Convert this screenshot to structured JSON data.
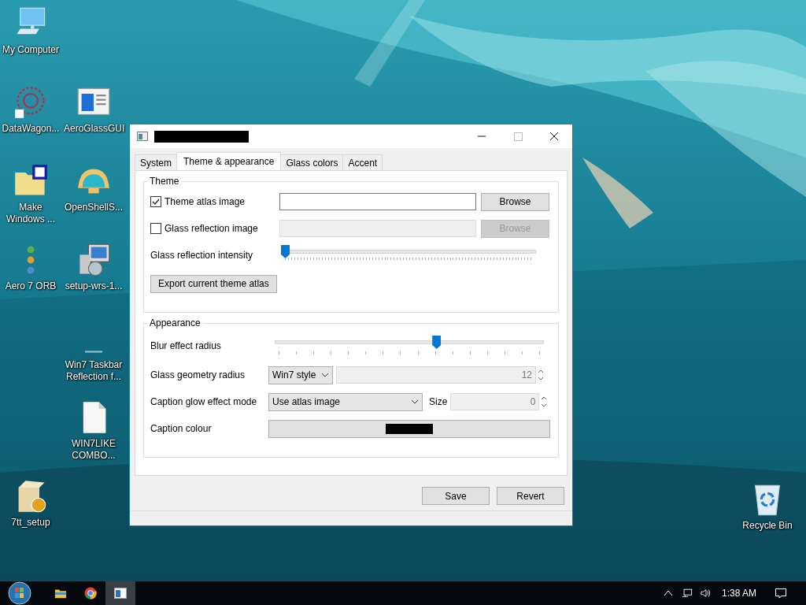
{
  "desktop_icons": [
    {
      "label": "My Computer",
      "kind": "computer"
    },
    {
      "label": "DataWagon...",
      "kind": "web"
    },
    {
      "label": "AeroGlassGUI",
      "kind": "window"
    },
    {
      "label": "Make Windows ...",
      "kind": "folder"
    },
    {
      "label": "OpenShellS...",
      "kind": "shell"
    },
    {
      "label": "Aero 7 ORB",
      "kind": "orbs"
    },
    {
      "label": "setup-wrs-1...",
      "kind": "installer"
    },
    {
      "label": "Win7 Taskbar Reflection f...",
      "kind": "blank"
    },
    {
      "label": "WIN7LIKE COMBO...",
      "kind": "file"
    },
    {
      "label": "7tt_setup",
      "kind": "box"
    }
  ],
  "recycle_bin": {
    "label": "Recycle Bin"
  },
  "tabs": [
    {
      "label": "System",
      "selected": false
    },
    {
      "label": "Theme & appearance",
      "selected": true
    },
    {
      "label": "Glass colors",
      "selected": false
    },
    {
      "label": "Accent",
      "selected": false
    }
  ],
  "theme_group": {
    "title": "Theme",
    "atlas_image": {
      "label": "Theme atlas image",
      "checked": true,
      "disabled": false,
      "button": "Browse"
    },
    "reflection_image": {
      "label": "Glass reflection image",
      "checked": false,
      "disabled": true,
      "button": "Browse"
    },
    "reflection_intensity": {
      "label": "Glass reflection intensity",
      "level": 0
    },
    "export_button": "Export current theme atlas"
  },
  "appearance_group": {
    "title": "Appearance",
    "blur_radius": {
      "label": "Blur effect radius",
      "level": 0.6
    },
    "geometry_radius": {
      "label": "Glass geometry radius",
      "select": "Win7 style",
      "value": "12",
      "disabled": true
    },
    "caption_glow": {
      "label": "Caption glow effect mode",
      "select": "Use atlas image",
      "size_label": "Size",
      "size_value": "0",
      "disabled": true
    },
    "caption_colour": {
      "label": "Caption colour",
      "color": "#000000"
    }
  },
  "buttons": [
    "Save",
    "Revert"
  ],
  "taskbar": {
    "apps": [
      {
        "kind": "explorer",
        "selected": false
      },
      {
        "kind": "chrome",
        "selected": false
      },
      {
        "kind": "app",
        "selected": true
      }
    ],
    "clock": "1:38 AM"
  }
}
